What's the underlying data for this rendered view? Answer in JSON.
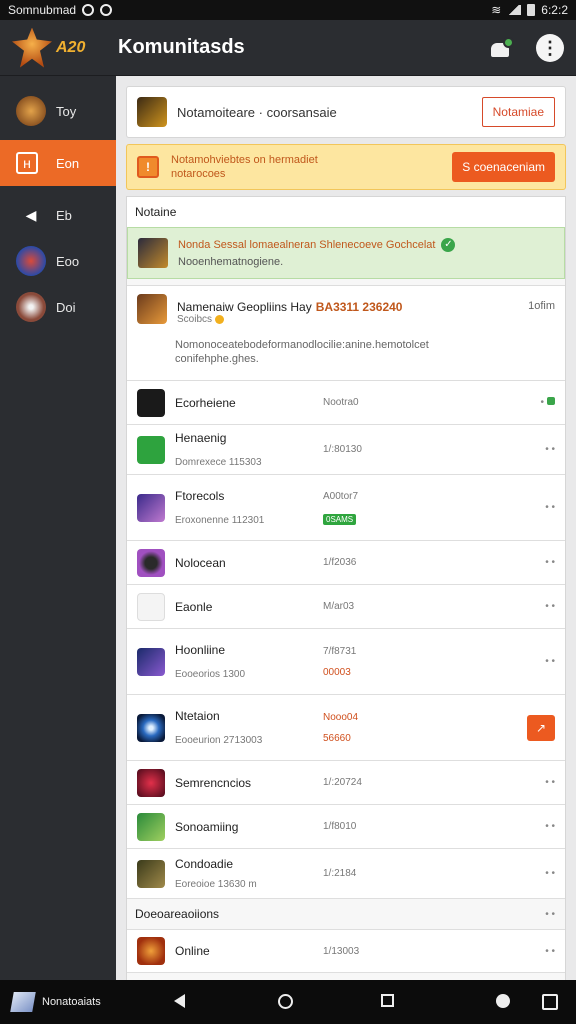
{
  "status_bar": {
    "left_text": "Somnubmad",
    "time": "6:2:2"
  },
  "header": {
    "logo_text": "A20",
    "title": "Komunitasds"
  },
  "sidebar": {
    "items": [
      {
        "label": "Toy",
        "icon": "game-hero-icon",
        "color": "#8a4a1c"
      },
      {
        "label": "Eon",
        "icon": "flag-icon",
        "color": "#ffffff"
      },
      {
        "label": "Eb",
        "icon": "send-icon",
        "color": "#2b2d31"
      },
      {
        "label": "Eoo",
        "icon": "avatar-icon",
        "color": "#3a5aa8"
      },
      {
        "label": "Doi",
        "icon": "star-icon",
        "color": "#6a4a3a"
      }
    ]
  },
  "notify": {
    "text": "Notamoiteare · coorsansaie",
    "button": "Notamiae"
  },
  "warning": {
    "line1": "Notamohviebtes on hermadiet",
    "line2": "notarocoes",
    "button": "S coenaceniam"
  },
  "list_heading": "Notaine",
  "success": {
    "title": "Nonda Sessal lomaealneran Shlenecoeve Gochcelat",
    "subtitle": "Nooenhematnogiene."
  },
  "featured": {
    "title": "Namenaiw Geopliins Hay",
    "accent": "BA3311 236240",
    "tag": "Scoibcs",
    "time": "1ofim",
    "desc": "Nomonoceatebodeformanodlocilie:anine.hemotolcet conifehphe.ghes."
  },
  "rows": [
    {
      "name": "Ecorheiene",
      "sub": "",
      "meta": "Nootra0",
      "meta2": "",
      "action": "•",
      "thumb": "#1a1a1a",
      "height": "h44",
      "type": "dotgreen"
    },
    {
      "name": "Henaenig",
      "sub": "Domrexece 115303",
      "meta": "1/:80130",
      "meta2": "",
      "action": "• •",
      "thumb": "#2ea33e",
      "height": "h50",
      "type": "normal"
    },
    {
      "name": "Ftorecols",
      "sub": "Eroxonenne 112301",
      "meta": "A00tor7",
      "meta2": "0SAMS",
      "action": "• •",
      "thumb": "#5a3aa0",
      "height": "h66",
      "type": "greentag"
    },
    {
      "name": "Nolocean",
      "sub": "",
      "meta": "1/f2036",
      "meta2": "",
      "action": "• •",
      "thumb": "#8a3aa0",
      "height": "h44",
      "type": "normal"
    },
    {
      "name": "Eaonle",
      "sub": "",
      "meta": "M/ar03",
      "meta2": "",
      "action": "• •",
      "thumb": "#f4f4f4",
      "height": "h44",
      "type": "normal"
    },
    {
      "name": "Hoonliine",
      "sub": "Eooeorios 1300",
      "meta": "7/f8731",
      "meta2": "00003",
      "action": "• •",
      "thumb": "#2a3a7a",
      "height": "h66",
      "type": "hl"
    },
    {
      "name": "Ntetaion",
      "sub": "Eooeurion 2713003",
      "meta": "Nooo04",
      "meta2": "56660",
      "action": "↗",
      "thumb": "#1a3a6a",
      "height": "h66",
      "type": "button"
    },
    {
      "name": "Semrencncios",
      "sub": "",
      "meta": "1/:20724",
      "meta2": "",
      "action": "• •",
      "thumb": "#7a1a2a",
      "height": "h44",
      "type": "normal"
    },
    {
      "name": "Sonoamiing",
      "sub": "",
      "meta": "1/f8010",
      "meta2": "",
      "action": "• •",
      "thumb": "#2a7a3a",
      "height": "h44",
      "type": "normal"
    },
    {
      "name": "Condoadie",
      "sub": "Eoreoioe 13630 m",
      "meta": "1/:2184",
      "meta2": "",
      "action": "• •",
      "thumb": "#5a4a2a",
      "height": "h50",
      "type": "normal"
    }
  ],
  "group_heading": "Doeoareaoiions",
  "last_row": {
    "name": "Online",
    "meta": "1/13003",
    "action": "• •",
    "thumb": "#c0501e"
  },
  "navbar": {
    "app_label": "Nonatoaiats"
  }
}
